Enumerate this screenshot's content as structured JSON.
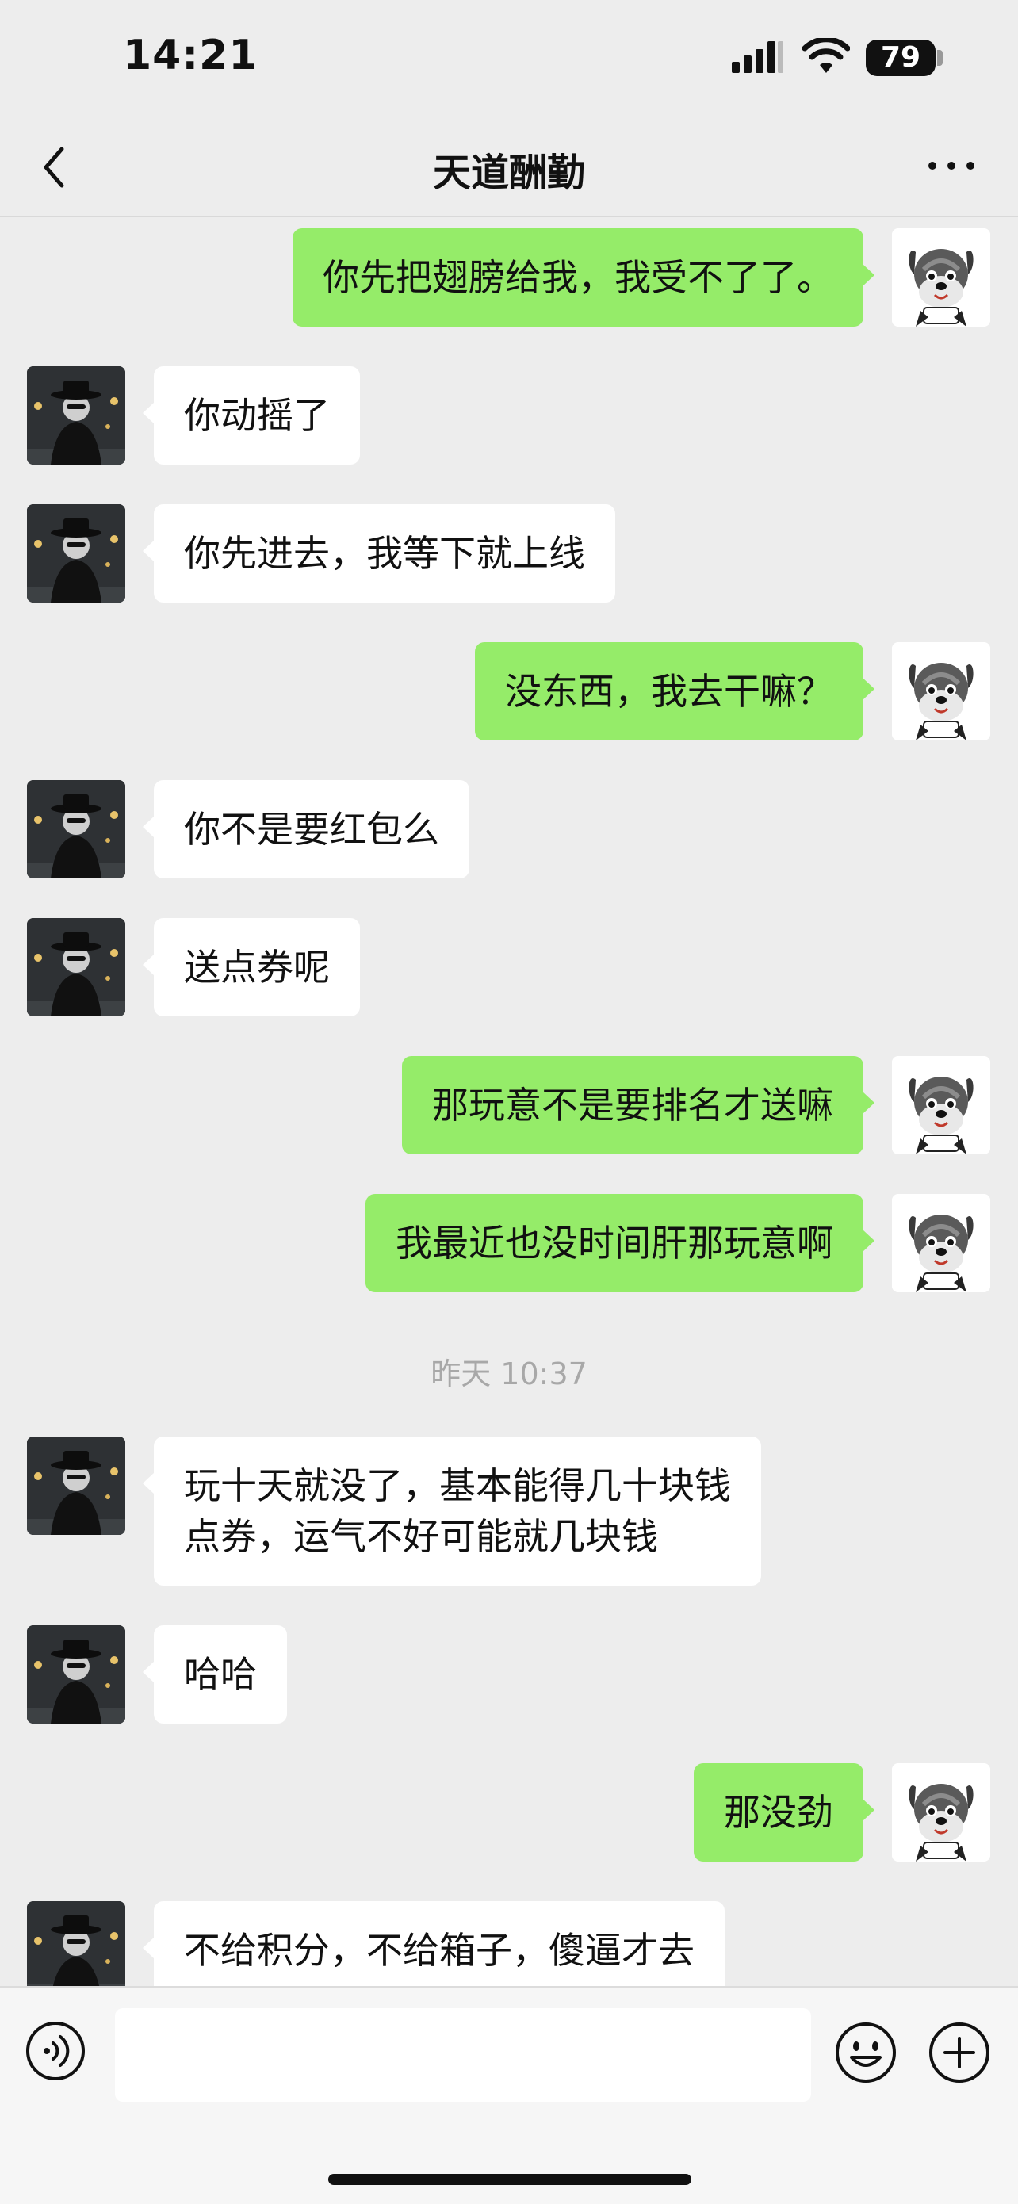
{
  "status_bar": {
    "time": "14:21",
    "battery": "79"
  },
  "nav": {
    "title": "天道酬勤"
  },
  "messages": [
    {
      "side": "right",
      "lines": [
        "你先把翅膀给我，我受不了了。"
      ]
    },
    {
      "side": "left",
      "lines": [
        "你动摇了"
      ]
    },
    {
      "side": "left",
      "lines": [
        "你先进去，我等下就上线"
      ]
    },
    {
      "side": "right",
      "lines": [
        "没东西，我去干嘛？"
      ]
    },
    {
      "side": "left",
      "lines": [
        "你不是要红包么"
      ]
    },
    {
      "side": "left",
      "lines": [
        "送点券呢"
      ]
    },
    {
      "side": "right",
      "lines": [
        "那玩意不是要排名才送嘛"
      ]
    },
    {
      "side": "right",
      "lines": [
        "我最近也没时间肝那玩意啊"
      ]
    },
    {
      "timestamp": "昨天 10:37"
    },
    {
      "side": "left",
      "lines": [
        "玩十天就没了，基本能得几十块钱",
        "点券，运气不好可能就几块钱"
      ]
    },
    {
      "side": "left",
      "lines": [
        "哈哈"
      ]
    },
    {
      "side": "right",
      "lines": [
        "那没劲"
      ]
    },
    {
      "side": "left",
      "lines": [
        "不给积分，不给箱子，傻逼才去"
      ]
    }
  ],
  "icons": {
    "back": "chevron-left-icon",
    "more": "more-dots-icon",
    "voice": "voice-icon",
    "emoji": "emoji-icon",
    "plus": "plus-icon"
  },
  "colors": {
    "background": "#ededed",
    "outgoing_bubble": "#95ec69",
    "incoming_bubble": "#ffffff",
    "timestamp": "#a8a8a8"
  }
}
